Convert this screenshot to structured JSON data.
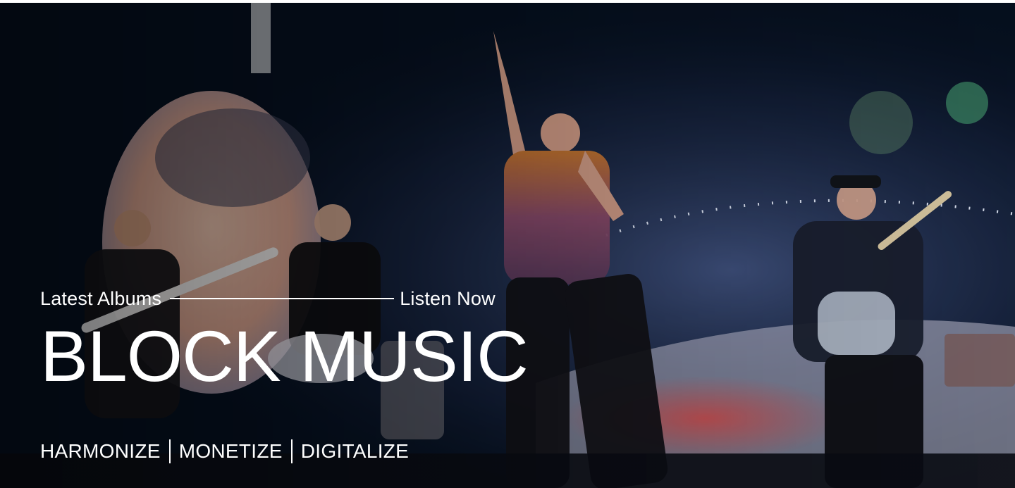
{
  "hero": {
    "image_alt": "concert-stage-photo",
    "eyebrow_left": "Latest Albums",
    "eyebrow_right": "Listen Now",
    "title": "BLOCK MUSIC",
    "tagline": [
      "HARMONIZE",
      "MONETIZE",
      "DIGITALIZE"
    ]
  },
  "colors": {
    "text": "#ffffff",
    "background": "#06101f"
  }
}
